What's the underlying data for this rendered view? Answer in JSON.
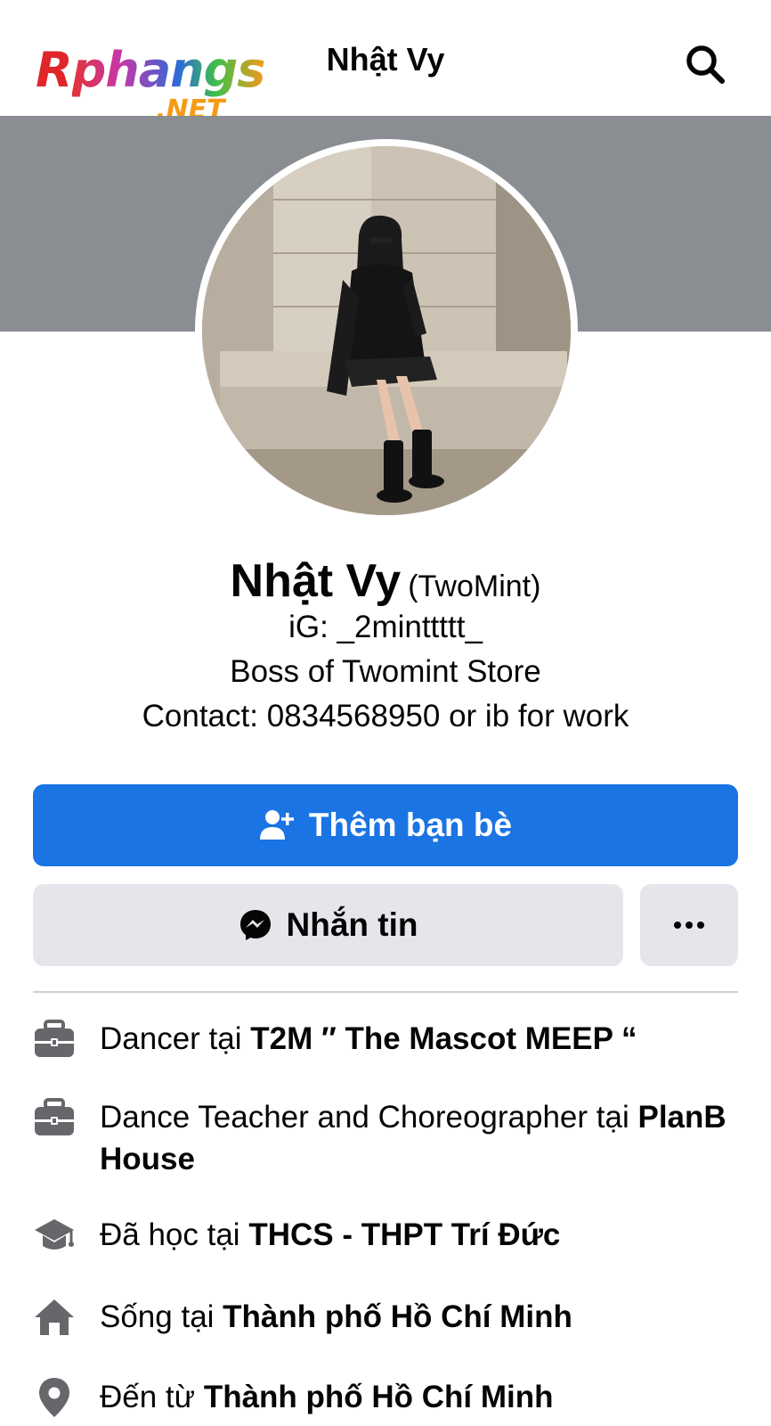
{
  "watermark": {
    "logo_first": "R",
    "logo_rest": "phangs",
    "logo_suffix": ".NET"
  },
  "header": {
    "title": "Nhật Vy",
    "search_icon": "search-icon"
  },
  "profile": {
    "name": "Nhật Vy",
    "alternate_name": "(TwoMint)",
    "bio": [
      "iG: _2minttttt_",
      "Boss of Twomint Store",
      "Contact: 0834568950 or ib for work"
    ]
  },
  "actions": {
    "add_friend_label": "Thêm bạn bè",
    "message_label": "Nhắn tin",
    "more_label": "•••"
  },
  "info_items": [
    {
      "icon": "briefcase-icon",
      "prefix": "Dancer tại ",
      "bold": "T2M ″ The Mascot MEEP “",
      "suffix": ""
    },
    {
      "icon": "briefcase-icon",
      "prefix": "Dance Teacher and Choreographer tại ",
      "bold": "PlanB House",
      "suffix": ""
    },
    {
      "icon": "graduation-cap-icon",
      "prefix": "Đã học tại ",
      "bold": "THCS - THPT Trí Đức",
      "suffix": ""
    },
    {
      "icon": "home-icon",
      "prefix": "Sống tại ",
      "bold": "Thành phố Hồ Chí Minh",
      "suffix": ""
    },
    {
      "icon": "location-pin-icon",
      "prefix": "Đến từ ",
      "bold": "Thành phố Hồ Chí Minh",
      "suffix": ""
    }
  ],
  "colors": {
    "primary": "#1b74e4",
    "secondary_button": "#e4e6eb",
    "cover": "#8a8d91",
    "icon_gray": "#65676b"
  }
}
